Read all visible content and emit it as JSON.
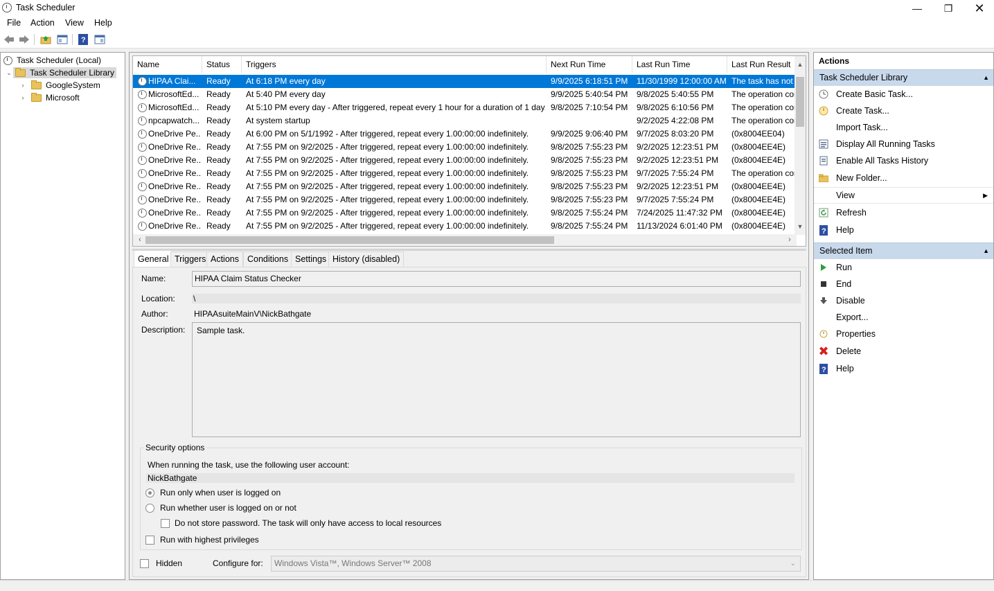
{
  "window": {
    "title": "Task Scheduler"
  },
  "menu": [
    "File",
    "Action",
    "View",
    "Help"
  ],
  "tree": {
    "root": "Task Scheduler (Local)",
    "library": "Task Scheduler Library",
    "children": [
      "GoogleSystem",
      "Microsoft"
    ]
  },
  "columns": [
    "Name",
    "Status",
    "Triggers",
    "Next Run Time",
    "Last Run Time",
    "Last Run Result"
  ],
  "tasks": [
    {
      "name": "HIPAA Clai...",
      "status": "Ready",
      "trigger": "At 6:18 PM every day",
      "next": "9/9/2025 6:18:51 PM",
      "last": "11/30/1999 12:00:00 AM",
      "result": "The task has not y"
    },
    {
      "name": "MicrosoftEd...",
      "status": "Ready",
      "trigger": "At 5:40 PM every day",
      "next": "9/9/2025 5:40:54 PM",
      "last": "9/8/2025 5:40:55 PM",
      "result": "The operation cor"
    },
    {
      "name": "MicrosoftEd...",
      "status": "Ready",
      "trigger": "At 5:10 PM every day - After triggered, repeat every 1 hour for a duration of 1 day.",
      "next": "9/8/2025 7:10:54 PM",
      "last": "9/8/2025 6:10:56 PM",
      "result": "The operation cor"
    },
    {
      "name": "npcapwatch...",
      "status": "Ready",
      "trigger": "At system startup",
      "next": "",
      "last": "9/2/2025 4:22:08 PM",
      "result": "The operation cor"
    },
    {
      "name": "OneDrive Pe...",
      "status": "Ready",
      "trigger": "At 6:00 PM on 5/1/1992 - After triggered, repeat every 1.00:00:00 indefinitely.",
      "next": "9/9/2025 9:06:40 PM",
      "last": "9/7/2025 8:03:20 PM",
      "result": "(0x8004EE04)"
    },
    {
      "name": "OneDrive Re...",
      "status": "Ready",
      "trigger": "At 7:55 PM on 9/2/2025 - After triggered, repeat every 1.00:00:00 indefinitely.",
      "next": "9/8/2025 7:55:23 PM",
      "last": "9/2/2025 12:23:51 PM",
      "result": "(0x8004EE4E)"
    },
    {
      "name": "OneDrive Re...",
      "status": "Ready",
      "trigger": "At 7:55 PM on 9/2/2025 - After triggered, repeat every 1.00:00:00 indefinitely.",
      "next": "9/8/2025 7:55:23 PM",
      "last": "9/2/2025 12:23:51 PM",
      "result": "(0x8004EE4E)"
    },
    {
      "name": "OneDrive Re...",
      "status": "Ready",
      "trigger": "At 7:55 PM on 9/2/2025 - After triggered, repeat every 1.00:00:00 indefinitely.",
      "next": "9/8/2025 7:55:23 PM",
      "last": "9/7/2025 7:55:24 PM",
      "result": "The operation cor"
    },
    {
      "name": "OneDrive Re...",
      "status": "Ready",
      "trigger": "At 7:55 PM on 9/2/2025 - After triggered, repeat every 1.00:00:00 indefinitely.",
      "next": "9/8/2025 7:55:23 PM",
      "last": "9/2/2025 12:23:51 PM",
      "result": "(0x8004EE4E)"
    },
    {
      "name": "OneDrive Re...",
      "status": "Ready",
      "trigger": "At 7:55 PM on 9/2/2025 - After triggered, repeat every 1.00:00:00 indefinitely.",
      "next": "9/8/2025 7:55:23 PM",
      "last": "9/7/2025 7:55:24 PM",
      "result": "(0x8004EE4E)"
    },
    {
      "name": "OneDrive Re...",
      "status": "Ready",
      "trigger": "At 7:55 PM on 9/2/2025 - After triggered, repeat every 1.00:00:00 indefinitely.",
      "next": "9/8/2025 7:55:24 PM",
      "last": "7/24/2025 11:47:32 PM",
      "result": "(0x8004EE4E)"
    },
    {
      "name": "OneDrive Re...",
      "status": "Ready",
      "trigger": "At 7:55 PM on 9/2/2025 - After triggered, repeat every 1.00:00:00 indefinitely.",
      "next": "9/8/2025 7:55:24 PM",
      "last": "11/13/2024 6:01:40 PM",
      "result": "(0x8004EE4E)"
    }
  ],
  "tabs": [
    "General",
    "Triggers",
    "Actions",
    "Conditions",
    "Settings",
    "History (disabled)"
  ],
  "general": {
    "name_label": "Name:",
    "name_value": "HIPAA Claim Status Checker",
    "location_label": "Location:",
    "location_value": "\\",
    "author_label": "Author:",
    "author_value": "HIPAAsuiteMainV\\NickBathgate",
    "description_label": "Description:",
    "description_value": "Sample task.",
    "security_title": "Security options",
    "security_account_text": "When running the task, use the following user account:",
    "security_account": "NickBathgate",
    "radio_logged_on": "Run only when user is logged on",
    "radio_whether": "Run whether user is logged on or not",
    "no_store_password": "Do not store password.  The task will only have access to local resources",
    "highest_privileges": "Run with highest privileges",
    "hidden_label": "Hidden",
    "configure_label": "Configure for:",
    "configure_value": "Windows Vista™, Windows Server™ 2008"
  },
  "actions_panel": {
    "header": "Actions",
    "section1": "Task Scheduler Library",
    "items1": [
      "Create Basic Task...",
      "Create Task...",
      "Import Task...",
      "Display All Running Tasks",
      "Enable All Tasks History",
      "New Folder...",
      "View",
      "Refresh",
      "Help"
    ],
    "section2": "Selected Item",
    "items2": [
      "Run",
      "End",
      "Disable",
      "Export...",
      "Properties",
      "Delete",
      "Help"
    ]
  },
  "colors": {
    "selection": "#0078d7",
    "section_header": "#c9d9ec"
  }
}
